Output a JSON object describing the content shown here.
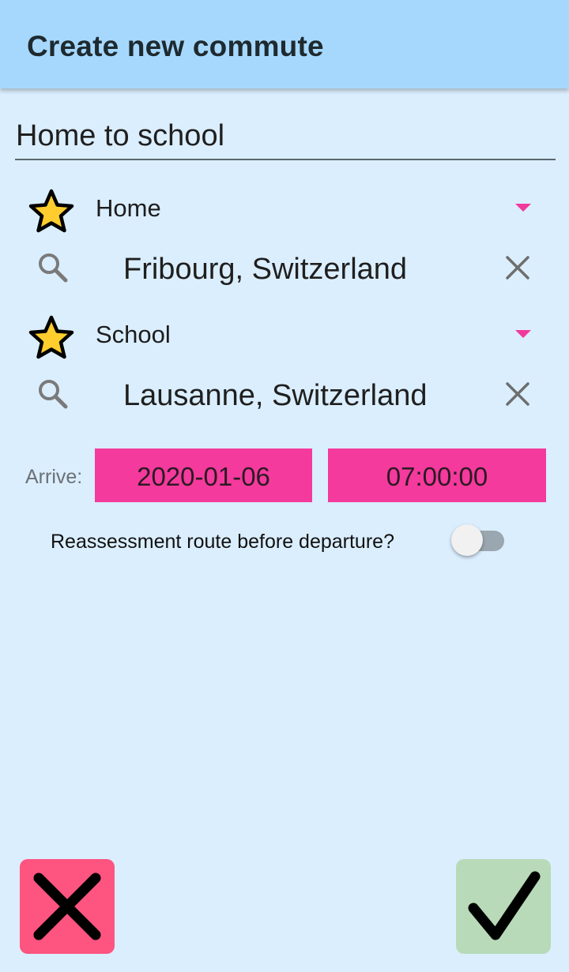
{
  "header": {
    "title": "Create new commute"
  },
  "commute": {
    "name": "Home to school"
  },
  "origin": {
    "label": "Home",
    "location": "Fribourg, Switzerland",
    "icon": "star-icon"
  },
  "destination": {
    "label": "School",
    "location": "Lausanne, Switzerland",
    "icon": "star-icon"
  },
  "arrive": {
    "label": "Arrive:",
    "date": "2020-01-06",
    "time": "07:00:00"
  },
  "reassess": {
    "label": "Reassessment route before departure?",
    "enabled": false
  },
  "actions": {
    "cancel_icon": "close-icon",
    "confirm_icon": "check-icon"
  },
  "colors": {
    "appbar": "#a6d8fe",
    "background": "#dbeefe",
    "accent": "#f43a9c",
    "cancel": "#fe5480",
    "confirm": "#b8dab8",
    "star": "#ffcd2d"
  }
}
